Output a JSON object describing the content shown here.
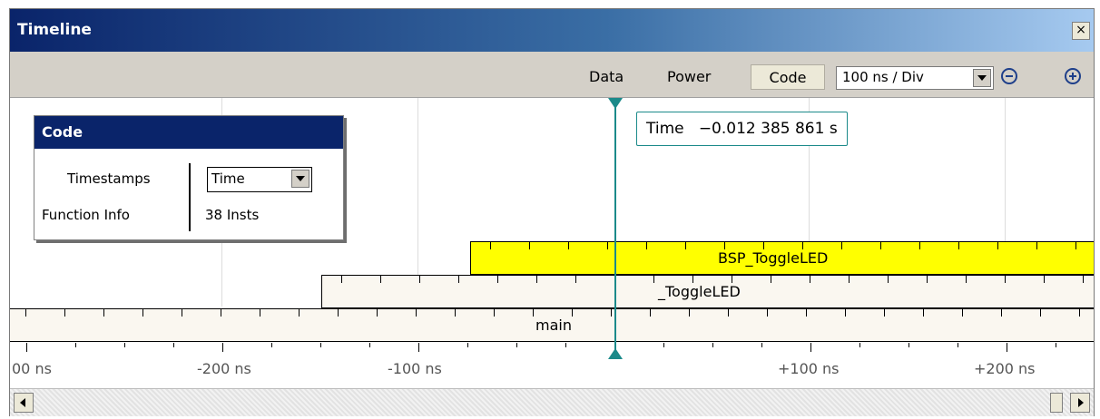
{
  "window": {
    "title": "Timeline",
    "close_label": "×"
  },
  "toolbar": {
    "tabs": [
      {
        "label": "Data"
      },
      {
        "label": "Power"
      },
      {
        "label": "Code",
        "active": true
      }
    ],
    "zoom_value": "100 ns / Div",
    "icons": [
      "zoom-out-icon",
      "zoom-in-icon"
    ]
  },
  "code_panel": {
    "title": "Code",
    "rows": [
      {
        "label": "Timestamps",
        "value": "Time"
      },
      {
        "label": "Function Info",
        "value": "38 Insts"
      }
    ]
  },
  "cursor": {
    "readout": "Time   −0.012 385 861 s"
  },
  "bars": [
    {
      "label": "BSP_ToggleLED",
      "color": "#ffff00"
    },
    {
      "label": "_ToggleLED",
      "color": "#faf7f0"
    },
    {
      "label": "main",
      "color": "#faf7f0"
    }
  ],
  "axis": {
    "labels": [
      "00 ns",
      "-200 ns",
      "-100 ns",
      "+100 ns",
      "+200 ns"
    ]
  },
  "colors": {
    "cursor": "#1b8a8a",
    "titlebar": "#0a246a",
    "highlight": "#ffff00"
  }
}
